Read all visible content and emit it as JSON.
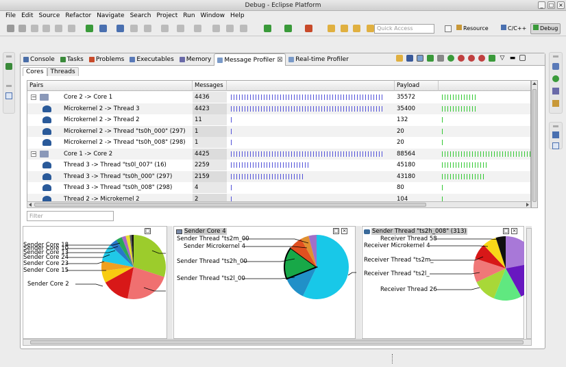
{
  "window": {
    "title": "Debug - Eclipse Platform"
  },
  "menu": [
    "File",
    "Edit",
    "Source",
    "Refactor",
    "Navigate",
    "Search",
    "Project",
    "Run",
    "Window",
    "Help"
  ],
  "toolbar": {
    "quick_access_placeholder": "Quick Access"
  },
  "perspectives": [
    {
      "label": "Resource"
    },
    {
      "label": "C/C++"
    },
    {
      "label": "Debug"
    }
  ],
  "view_tabs": [
    {
      "label": "Console",
      "color": "#4a6ea8"
    },
    {
      "label": "Tasks",
      "color": "#3a8a3a"
    },
    {
      "label": "Problems",
      "color": "#c84a2a"
    },
    {
      "label": "Executables",
      "color": "#5a7ab8"
    },
    {
      "label": "Memory",
      "color": "#6a6aa8"
    },
    {
      "label": "Message Profiler ☒",
      "color": "#7a9ac8"
    },
    {
      "label": "Real-time Profiler",
      "color": "#7a9ac8"
    }
  ],
  "sub_tabs": [
    {
      "label": "Cores"
    },
    {
      "label": "Threads"
    }
  ],
  "table": {
    "columns": [
      "Pairs",
      "Messages",
      "Payload"
    ],
    "max_messages": 4436,
    "max_payload": 88564,
    "rows": [
      {
        "type": "core",
        "label": "Core 2 -> Core 1",
        "messages": "4436",
        "msg_val": 4436,
        "payload": "35572",
        "pay_val": 35572
      },
      {
        "type": "thread",
        "label": "Microkernel 2 -> Thread 3",
        "messages": "4423",
        "msg_val": 4423,
        "payload": "35400",
        "pay_val": 35400
      },
      {
        "type": "thread",
        "label": "Microkernel 2 -> Thread 2",
        "messages": "11",
        "msg_val": 11,
        "payload": "132",
        "pay_val": 132
      },
      {
        "type": "thread",
        "label": "Microkernel 2 -> Thread \"ts0h_000\" (297)",
        "messages": "1",
        "msg_val": 1,
        "payload": "20",
        "pay_val": 20
      },
      {
        "type": "thread",
        "label": "Microkernel 2 -> Thread \"ts0h_008\" (298)",
        "messages": "1",
        "msg_val": 1,
        "payload": "20",
        "pay_val": 20
      },
      {
        "type": "core",
        "label": "Core 1 -> Core 2",
        "messages": "4425",
        "msg_val": 4425,
        "payload": "88564",
        "pay_val": 88564
      },
      {
        "type": "thread",
        "label": "Thread 3 -> Thread \"ts0l_007\" (16)",
        "messages": "2259",
        "msg_val": 2259,
        "payload": "45180",
        "pay_val": 45180
      },
      {
        "type": "thread",
        "label": "Thread 3 -> Thread \"ts0h_000\" (297)",
        "messages": "2159",
        "msg_val": 2159,
        "payload": "43180",
        "pay_val": 43180
      },
      {
        "type": "thread",
        "label": "Thread 3 -> Thread \"ts0h_008\" (298)",
        "messages": "4",
        "msg_val": 4,
        "payload": "80",
        "pay_val": 80
      },
      {
        "type": "thread",
        "label": "Thread 2 -> Microkernel 2",
        "messages": "2",
        "msg_val": 2,
        "payload": "104",
        "pay_val": 104
      }
    ]
  },
  "filter": {
    "placeholder": "Filter"
  },
  "chart_data": [
    {
      "type": "pie",
      "title": "",
      "labels": [
        "Sender Core 18",
        "Sender Core 10",
        "Sender Core 13",
        "Sender Core 24",
        "Sender Core 23",
        "Sender Core 15",
        "Sender Core 2"
      ],
      "slices": [
        {
          "value": 30,
          "color": "#9ccc2c"
        },
        {
          "value": 23,
          "color": "#f07070"
        },
        {
          "value": 14,
          "color": "#d81818"
        },
        {
          "value": 6,
          "color": "#f8cc10"
        },
        {
          "value": 5,
          "color": "#f0a020"
        },
        {
          "value": 9,
          "color": "#20c8e8"
        },
        {
          "value": 4,
          "color": "#2878c8"
        },
        {
          "value": 3,
          "color": "#28a858"
        },
        {
          "value": 2,
          "color": "#a868c8"
        },
        {
          "value": 2,
          "color": "#e8e030"
        },
        {
          "value": 1,
          "color": "#606060"
        },
        {
          "value": 1,
          "color": "#101010"
        }
      ]
    },
    {
      "type": "pie",
      "title": "Sender Core 4",
      "labels": [
        "Sender Thread \"ts2m_00",
        "Sender Microkernel 4",
        "Sender Thread \"ts2h_00",
        "Sender Thread \"ts2l_00"
      ],
      "slices": [
        {
          "value": 57,
          "color": "#18c8e8"
        },
        {
          "value": 12,
          "color": "#2090c8"
        },
        {
          "value": 16,
          "color": "#18a848"
        },
        {
          "value": 7,
          "color": "#e05020"
        },
        {
          "value": 4,
          "color": "#e09030"
        },
        {
          "value": 4,
          "color": "#a070c8"
        }
      ]
    },
    {
      "type": "pie",
      "title": "Sender Thread \"ts2h_008\" (313)",
      "labels": [
        "Receiver Thread 58",
        "Receiver Microkernel 4",
        "Receiver Thread \"ts2m_",
        "Receiver Thread \"ts2l_",
        "Receiver Thread 26"
      ],
      "slices": [
        {
          "value": 22,
          "color": "#a878d8"
        },
        {
          "value": 20,
          "color": "#6818c0"
        },
        {
          "value": 14,
          "color": "#60e880"
        },
        {
          "value": 12,
          "color": "#a8d838"
        },
        {
          "value": 12,
          "color": "#f07878"
        },
        {
          "value": 8,
          "color": "#d81818"
        },
        {
          "value": 7,
          "color": "#f8d818"
        },
        {
          "value": 5,
          "color": "#101010"
        }
      ]
    }
  ]
}
